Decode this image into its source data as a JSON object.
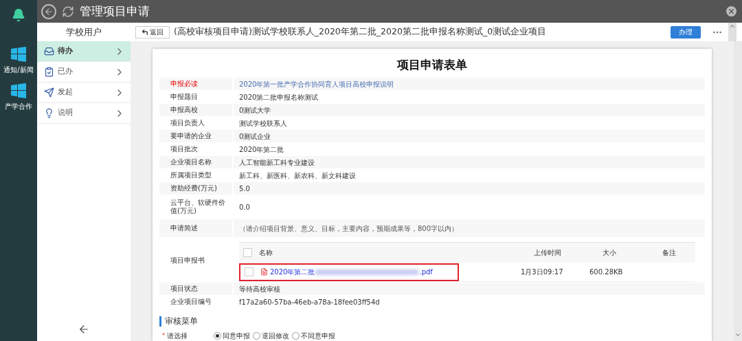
{
  "app": {
    "title": "管理项目申请"
  },
  "rail": [
    {
      "label": "通知/新闻"
    },
    {
      "label": "产学合作"
    }
  ],
  "sidebar": {
    "title": "学校用户",
    "items": [
      {
        "label": "待办",
        "selected": true,
        "kind": "inbox"
      },
      {
        "label": "已办",
        "selected": false,
        "kind": "clipboard"
      },
      {
        "label": "发起",
        "selected": false,
        "kind": "send"
      },
      {
        "label": "说明",
        "selected": false,
        "kind": "bulb"
      }
    ]
  },
  "header": {
    "back_button": "返回",
    "title": "(高校审核项目申请)测试学校联系人_2020年第二批_2020第二批申报名称测试_0测试企业项目",
    "action_button": "办理"
  },
  "form": {
    "title": "项目申请表单",
    "fields_before": [
      {
        "label": "申报必读",
        "value": "2020年第一批产学合作协同育人项目高校申报说明",
        "kind": "required_link"
      },
      {
        "label": "申报题目",
        "value": "2020第二批申报名称测试",
        "kind": "text"
      },
      {
        "label": "申报高校",
        "value": "0测试大学",
        "kind": "text"
      },
      {
        "label": "项目负责人",
        "value": "测试学校联系人",
        "kind": "text"
      },
      {
        "label": "要申请的企业",
        "value": "0测试企业",
        "kind": "text"
      },
      {
        "label": "项目批次",
        "value": "2020年第二批",
        "kind": "text"
      },
      {
        "label": "企业项目名称",
        "value": "人工智能新工科专业建设",
        "kind": "text"
      },
      {
        "label": "所属项目类型",
        "value": "新工科、新医科、新农科、新文科建设",
        "kind": "text"
      },
      {
        "label": "资助经费(万元)",
        "value": "5.0",
        "kind": "text"
      },
      {
        "label": "云平台、软硬件价值(万元)",
        "value": "0.0",
        "kind": "tall"
      },
      {
        "label": "申请简述",
        "value": "（请介绍项目背景、意义、目标，主要内容，预期成果等，800字以内）",
        "kind": "note"
      }
    ],
    "attachment": {
      "label": "项目申报书",
      "columns": [
        "名称",
        "上传时间",
        "大小",
        "备注"
      ],
      "header_checked": false,
      "files": [
        {
          "name_start": "2020年第二批",
          "name_end": ".pdf",
          "uploaded": "1月3日09:17",
          "size": "600.28KB",
          "checked": false,
          "highlighted": true
        }
      ]
    },
    "fields_after": [
      {
        "label": "项目状态",
        "value": "等待高校审核",
        "kind": "text"
      },
      {
        "label": "企业项目编号",
        "value": "f17a2a60-57ba-46eb-a78a-18fee03ff54d",
        "kind": "text"
      }
    ]
  },
  "review": {
    "title": "审核菜单",
    "required_mark": "*",
    "prompt": "请选择",
    "options": [
      {
        "label": "同意申报",
        "selected": true
      },
      {
        "label": "退回修改",
        "selected": false
      },
      {
        "label": "不同意申报",
        "selected": false
      }
    ]
  }
}
